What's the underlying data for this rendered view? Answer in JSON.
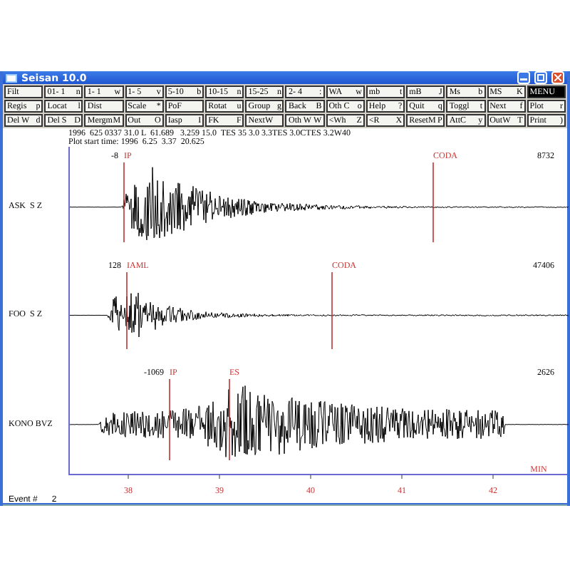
{
  "window": {
    "title": "Seisan 10.0"
  },
  "button_rows": [
    [
      {
        "label": "Filt",
        "selected": false
      },
      {
        "label": "01- 1",
        "key": "n",
        "selected": false
      },
      {
        "label": "1- 1",
        "key": "w",
        "selected": false
      },
      {
        "label": "1- 5",
        "key": "v",
        "selected": false
      },
      {
        "label": "5-10",
        "key": "b",
        "selected": false
      },
      {
        "label": "10-15",
        "key": "n",
        "selected": false
      },
      {
        "label": "15-25",
        "key": "n",
        "selected": false
      },
      {
        "label": "2- 4",
        "key": ":",
        "selected": false
      },
      {
        "label": "WA",
        "key": "w",
        "selected": false
      },
      {
        "label": "mb",
        "key": "t",
        "selected": false
      },
      {
        "label": "mB",
        "key": "J",
        "selected": false
      },
      {
        "label": "Ms",
        "key": "b",
        "selected": false
      },
      {
        "label": "MS",
        "key": "K",
        "selected": false
      },
      {
        "label": "MENU",
        "selected": true
      }
    ],
    [
      {
        "label": "Regis",
        "key": "p",
        "selected": false
      },
      {
        "label": "Locat",
        "key": "l",
        "selected": false
      },
      {
        "label": "Dist",
        "selected": false
      },
      {
        "label": "Scale",
        "key": "*",
        "selected": false
      },
      {
        "label": "PoF",
        "selected": false
      },
      {
        "label": "Rotat",
        "key": "u",
        "selected": false
      },
      {
        "label": "Group",
        "key": "g",
        "selected": false
      },
      {
        "label": "Back",
        "key": "B",
        "selected": false
      },
      {
        "label": "Oth C",
        "key": "o",
        "selected": false
      },
      {
        "label": "Help",
        "key": "?",
        "selected": false
      },
      {
        "label": "Quit",
        "key": "q",
        "selected": false
      },
      {
        "label": "Toggl",
        "key": "t",
        "selected": false
      },
      {
        "label": "Next",
        "key": "f",
        "selected": false
      },
      {
        "label": "Plot",
        "key": "r",
        "selected": false
      }
    ],
    [
      {
        "label": "Del W",
        "key": "d",
        "selected": false
      },
      {
        "label": "Del S",
        "key": "D",
        "selected": false
      },
      {
        "label": "Mergm",
        "key": "M",
        "selected": false
      },
      {
        "label": "Out",
        "key": "O",
        "selected": false
      },
      {
        "label": "Iasp",
        "key": "I",
        "selected": false
      },
      {
        "label": "FK",
        "key": "F",
        "selected": false
      },
      {
        "label": "NextW",
        "selected": false
      },
      {
        "label": "Oth W",
        "key": "W",
        "selected": false
      },
      {
        "label": "<Wh",
        "key": "Z",
        "selected": false
      },
      {
        "label": "<R",
        "key": "X",
        "selected": false
      },
      {
        "label": "ResetM",
        "key": "P",
        "selected": false
      },
      {
        "label": "AttC",
        "key": "y",
        "selected": false
      },
      {
        "label": "OutW",
        "key": "T",
        "selected": false
      },
      {
        "label": "Print",
        "key": ")",
        "selected": false
      }
    ]
  ],
  "header_lines": [
    "1996  625 0337 31.0 L  61.689   3.259 15.0  TES 35 3.0 3.3TES 3.0CTES 3.2W40",
    "Plot start time: 1996  6.25  3.37  20.625"
  ],
  "traces": [
    {
      "station": "ASK  S Z",
      "min": "-8",
      "max": "8732",
      "picks": [
        {
          "label": "IP"
        },
        {
          "label": "CODA"
        }
      ]
    },
    {
      "station": "FOO  S Z",
      "min": "128",
      "max": "47406",
      "picks": [
        {
          "label": "IAML"
        },
        {
          "label": "CODA"
        }
      ]
    },
    {
      "station": "KONO BVZ",
      "min": "-1069",
      "max": "2626",
      "picks": [
        {
          "label": "IP"
        },
        {
          "label": "ES"
        }
      ]
    }
  ],
  "time_axis": {
    "ticks": [
      "38",
      "39",
      "40",
      "41",
      "42"
    ],
    "unit": "MIN"
  },
  "status_bar": {
    "label": "Event #",
    "value": "2"
  }
}
